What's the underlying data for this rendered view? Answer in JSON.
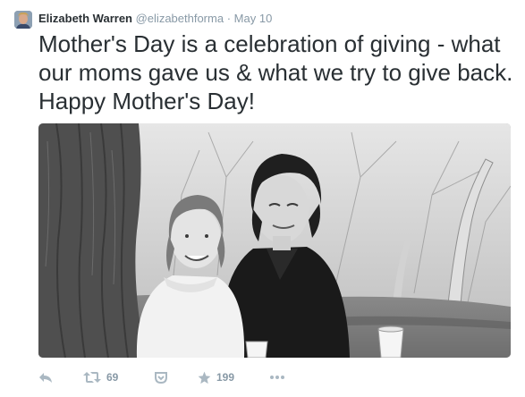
{
  "tweet": {
    "author": {
      "name": "Elizabeth Warren",
      "handle": "@elizabethforma",
      "separator": "·",
      "date": "May 10"
    },
    "text": "Mother's Day is a celebration of giving - what our moms gave us & what we try to give back. Happy Mother's Day!",
    "media": {
      "icon": "photo"
    },
    "actions": {
      "reply": {
        "icon": "reply-icon"
      },
      "retweet": {
        "icon": "retweet-icon",
        "count": "69"
      },
      "pocket": {
        "icon": "pocket-icon"
      },
      "favorite": {
        "icon": "star-icon",
        "count": "199"
      },
      "more": {
        "icon": "more-icon"
      }
    }
  },
  "colors": {
    "text": "#292f33",
    "muted": "#8899a6",
    "action_icon": "#aab8c2"
  }
}
